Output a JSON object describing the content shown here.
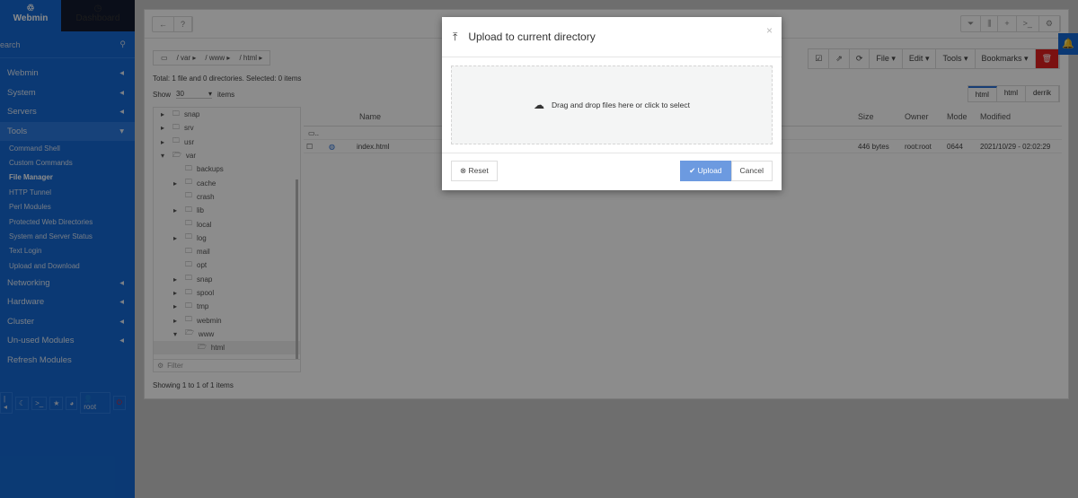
{
  "sidebar": {
    "tabs": [
      "Webmin",
      "Dashboard"
    ],
    "search_placeholder": "Search",
    "items": [
      {
        "label": "Webmin"
      },
      {
        "label": "System"
      },
      {
        "label": "Servers"
      },
      {
        "label": "Tools"
      }
    ],
    "tools_sub": [
      "Command Shell",
      "Custom Commands",
      "File Manager",
      "HTTP Tunnel",
      "Perl Modules",
      "Protected Web Directories",
      "System and Server Status",
      "Text Login",
      "Upload and Download"
    ],
    "items2": [
      "Networking",
      "Hardware",
      "Cluster",
      "Un-used Modules",
      "Refresh Modules"
    ],
    "user": "root"
  },
  "breadcrumb": [
    "var",
    "www",
    "html"
  ],
  "toolbar": {
    "file": "File",
    "edit": "Edit",
    "tools": "Tools",
    "bookmarks": "Bookmarks"
  },
  "info": "Total: 1 file and 0 directories. Selected: 0 items",
  "show": {
    "label": "Show",
    "value": "30",
    "suffix": "items"
  },
  "path_tabs": [
    "html",
    "html",
    "derrik"
  ],
  "tree": [
    {
      "n": "snap",
      "d": 0,
      "c": 1
    },
    {
      "n": "srv",
      "d": 0,
      "c": 1
    },
    {
      "n": "usr",
      "d": 0,
      "c": 1
    },
    {
      "n": "var",
      "d": 0,
      "o": 1
    },
    {
      "n": "backups",
      "d": 1
    },
    {
      "n": "cache",
      "d": 1,
      "c": 1
    },
    {
      "n": "crash",
      "d": 1
    },
    {
      "n": "lib",
      "d": 1,
      "c": 1
    },
    {
      "n": "local",
      "d": 1
    },
    {
      "n": "log",
      "d": 1,
      "c": 1
    },
    {
      "n": "mail",
      "d": 1
    },
    {
      "n": "opt",
      "d": 1
    },
    {
      "n": "snap",
      "d": 1,
      "c": 1
    },
    {
      "n": "spool",
      "d": 1,
      "c": 1
    },
    {
      "n": "tmp",
      "d": 1,
      "c": 1
    },
    {
      "n": "webmin",
      "d": 1,
      "c": 1
    },
    {
      "n": "www",
      "d": 1,
      "o": 1
    },
    {
      "n": "html",
      "d": 2,
      "s": 1
    }
  ],
  "filter_placeholder": "Filter",
  "table": {
    "headers": [
      "Name",
      "Size",
      "Owner",
      "Mode",
      "Modified"
    ],
    "parent": "..",
    "rows": [
      {
        "name": "index.html",
        "size": "446 bytes",
        "owner": "root:root",
        "mode": "0644",
        "modified": "2021/10/29 - 02:02:29"
      }
    ]
  },
  "footer": "Showing 1 to 1 of 1 items",
  "modal": {
    "title": "Upload to current directory",
    "drop_text": "Drag and drop files here or click to select",
    "reset": "Reset",
    "upload": "Upload",
    "cancel": "Cancel"
  }
}
